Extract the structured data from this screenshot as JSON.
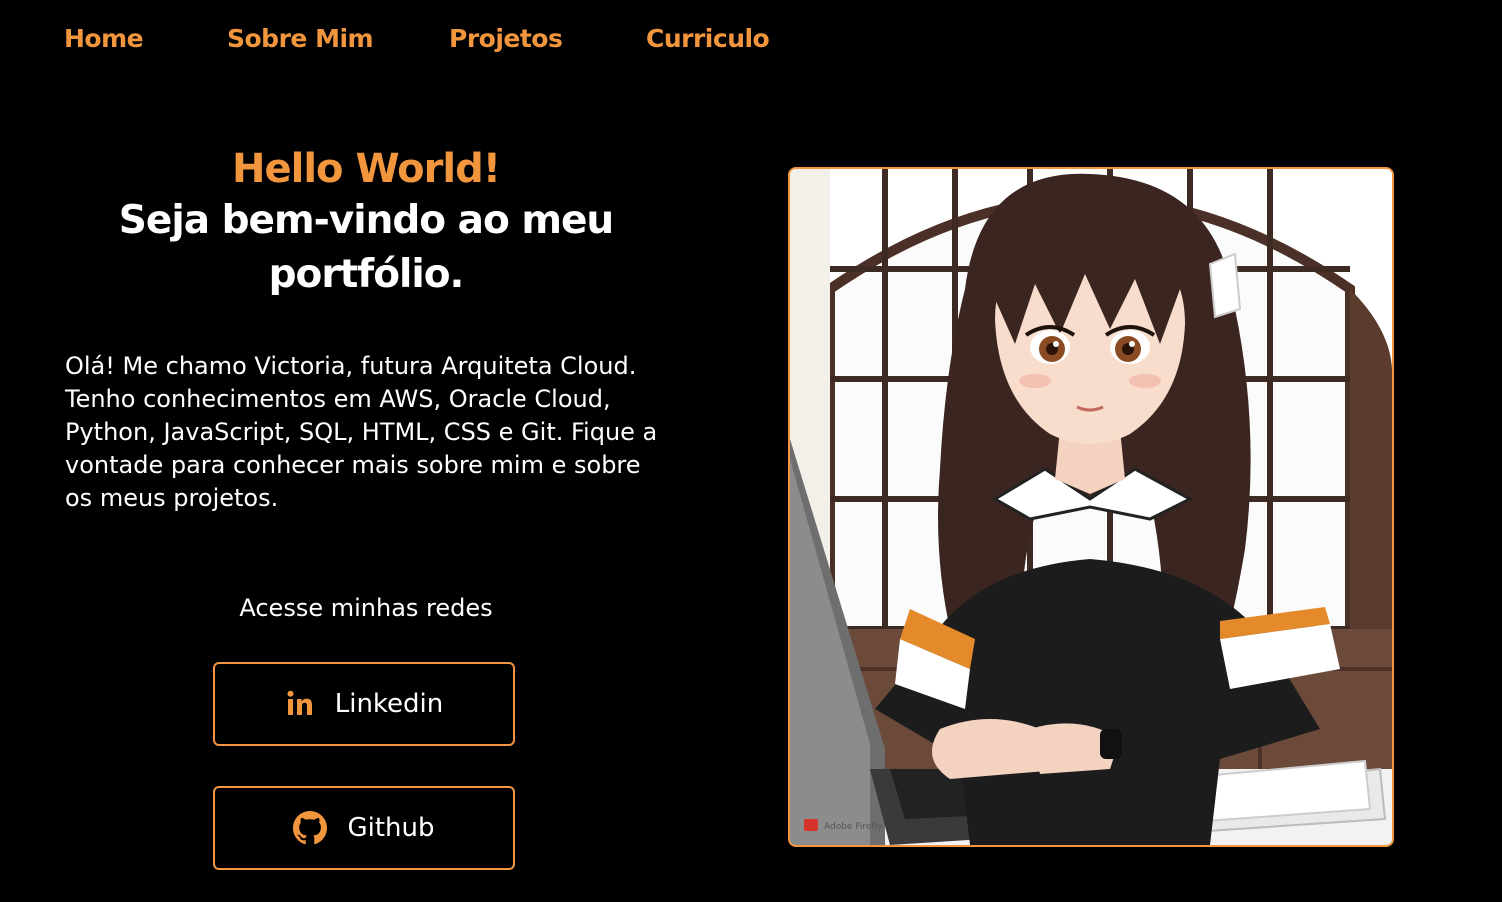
{
  "nav": {
    "items": [
      {
        "label": "Home"
      },
      {
        "label": "Sobre Mim"
      },
      {
        "label": "Projetos"
      },
      {
        "label": "Curriculo"
      }
    ]
  },
  "hero": {
    "greeting": "Hello World!",
    "welcome": "Seja bem-vindo ao meu portfólio.",
    "bio": "Olá! Me chamo Victoria, futura Arquiteta Cloud. Tenho conhecimentos em AWS, Oracle Cloud, Python, JavaScript, SQL, HTML, CSS e Git. Fique a vontade para conhecer mais sobre mim e sobre os meus projetos."
  },
  "social": {
    "label": "Acesse minhas redes",
    "linkedin": {
      "label": "Linkedin",
      "icon": "linkedin-icon"
    },
    "github": {
      "label": "Github",
      "icon": "github-icon"
    }
  },
  "photo": {
    "watermark": "Adobe Firefly"
  },
  "colors": {
    "background": "#000000",
    "accent": "#f2963e",
    "text": "#ffffff"
  }
}
